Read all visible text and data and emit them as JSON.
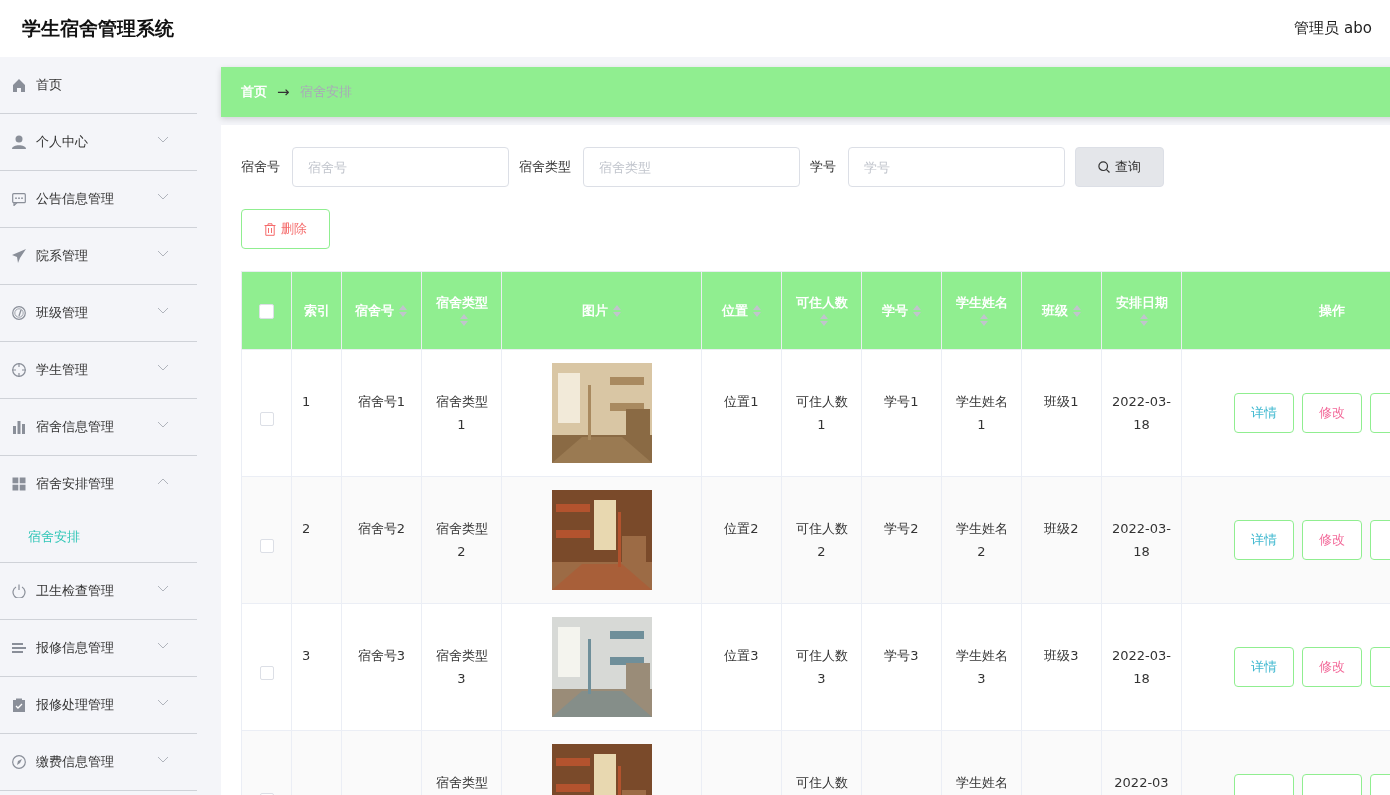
{
  "header": {
    "title": "学生宿舍管理系统",
    "user": "管理员 abo"
  },
  "sidebar": {
    "items": [
      {
        "label": "首页",
        "kind": "link"
      },
      {
        "label": "个人中心",
        "kind": "submenu",
        "expanded": false
      },
      {
        "label": "公告信息管理",
        "kind": "submenu",
        "expanded": false
      },
      {
        "label": "院系管理",
        "kind": "submenu",
        "expanded": false
      },
      {
        "label": "班级管理",
        "kind": "submenu",
        "expanded": false
      },
      {
        "label": "学生管理",
        "kind": "submenu",
        "expanded": false
      },
      {
        "label": "宿舍信息管理",
        "kind": "submenu",
        "expanded": false
      },
      {
        "label": "宿舍安排管理",
        "kind": "submenu",
        "expanded": true,
        "children": [
          {
            "label": "宿舍安排",
            "selected": true
          }
        ]
      },
      {
        "label": "卫生检查管理",
        "kind": "submenu",
        "expanded": false
      },
      {
        "label": "报修信息管理",
        "kind": "submenu",
        "expanded": false
      },
      {
        "label": "报修处理管理",
        "kind": "submenu",
        "expanded": false
      },
      {
        "label": "缴费信息管理",
        "kind": "submenu",
        "expanded": false
      }
    ]
  },
  "breadcrumb": {
    "items": [
      "首页",
      "宿舍安排"
    ],
    "separator": "→"
  },
  "search": {
    "fields": [
      {
        "label": "宿舍号",
        "placeholder": "宿舍号"
      },
      {
        "label": "宿舍类型",
        "placeholder": "宿舍类型"
      },
      {
        "label": "学号",
        "placeholder": "学号"
      }
    ],
    "button": "查询"
  },
  "delete_button": "删除",
  "table": {
    "select_all": {
      "checked": false
    },
    "columns": [
      {
        "label": "索引",
        "sortable": false
      },
      {
        "label": "宿舍号",
        "sortable": true
      },
      {
        "label": "宿舍类型",
        "sortable": true
      },
      {
        "label": "图片",
        "sortable": true
      },
      {
        "label": "位置",
        "sortable": true
      },
      {
        "label": "可住人数",
        "sortable": true
      },
      {
        "label": "学号",
        "sortable": true
      },
      {
        "label": "学生姓名",
        "sortable": true
      },
      {
        "label": "班级",
        "sortable": true
      },
      {
        "label": "安排日期",
        "sortable": true
      },
      {
        "label": "操作",
        "sortable": false
      }
    ],
    "rows": [
      {
        "checked": false,
        "cells": [
          "1",
          "宿舍号1",
          "宿舍类型1",
          {
            "kind": "picture"
          },
          "位置1",
          "可住人数1",
          "学号1",
          "学生姓名1",
          "班级1",
          "2022-03-18"
        ],
        "actions": [
          {
            "kind": "detail",
            "label": "详情"
          },
          {
            "kind": "edit",
            "label": "修改"
          },
          {
            "kind": "delete"
          }
        ]
      },
      {
        "checked": false,
        "cells": [
          "2",
          "宿舍号2",
          "宿舍类型2",
          {
            "kind": "picture"
          },
          "位置2",
          "可住人数2",
          "学号2",
          "学生姓名2",
          "班级2",
          "2022-03-18"
        ],
        "actions": [
          {
            "kind": "detail",
            "label": "详情"
          },
          {
            "kind": "edit",
            "label": "修改"
          },
          {
            "kind": "delete"
          }
        ]
      },
      {
        "checked": false,
        "cells": [
          "3",
          "宿舍号3",
          "宿舍类型3",
          {
            "kind": "picture"
          },
          "位置3",
          "可住人数3",
          "学号3",
          "学生姓名3",
          "班级3",
          "2022-03-18"
        ],
        "actions": [
          {
            "kind": "detail",
            "label": "详情"
          },
          {
            "kind": "edit",
            "label": "修改"
          },
          {
            "kind": "delete"
          }
        ]
      },
      {
        "checked": false,
        "cells": [
          null,
          null,
          "宿舍类型",
          {
            "kind": "picture"
          },
          null,
          "可住人数",
          null,
          "学生姓名",
          null,
          "2022-03"
        ],
        "actions": [
          {
            "kind": "detail"
          },
          {
            "kind": "edit"
          },
          {
            "kind": "delete"
          }
        ]
      }
    ]
  }
}
